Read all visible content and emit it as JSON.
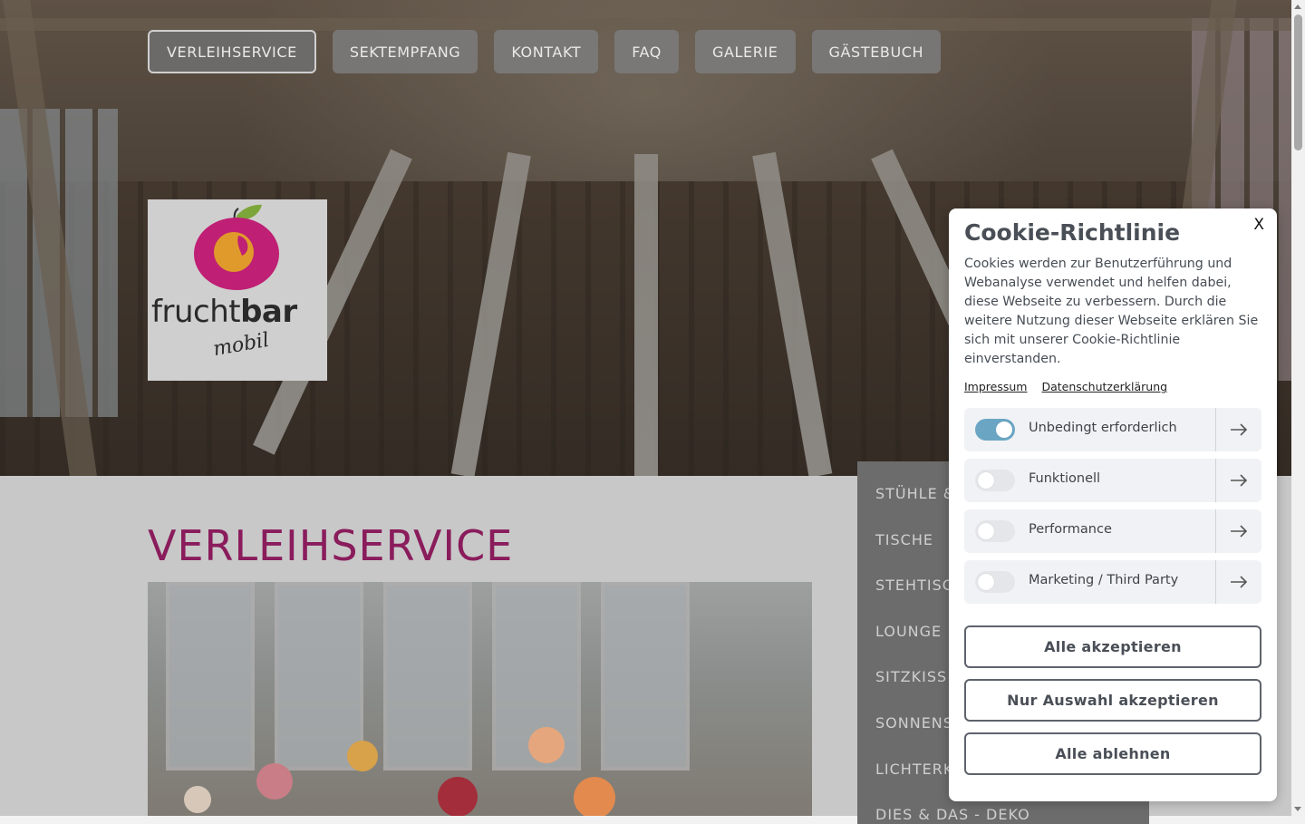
{
  "nav": {
    "items": [
      {
        "label": "VERLEIHSERVICE",
        "active": true
      },
      {
        "label": "SEKTEMPFANG",
        "active": false
      },
      {
        "label": "KONTAKT",
        "active": false
      },
      {
        "label": "FAQ",
        "active": false
      },
      {
        "label": "GALERIE",
        "active": false
      },
      {
        "label": "GÄSTEBUCH",
        "active": false
      }
    ]
  },
  "logo": {
    "word_light": "frucht",
    "word_bold": "bar",
    "sub": "mobil"
  },
  "main": {
    "title": "VERLEIHSERVICE"
  },
  "side_menu": {
    "items": [
      "STÜHLE &",
      "TISCHE",
      "STEHTISC",
      "LOUNGE",
      "SITZKISS",
      "SONNENS",
      "LICHTERK",
      "DIES & DAS - DEKO"
    ]
  },
  "cookie": {
    "title": "Cookie-Richtlinie",
    "close": "X",
    "text": "Cookies werden zur Benutzerführung und Webanalyse verwendet und helfen dabei, diese Webseite zu verbessern. Durch die weitere Nutzung dieser Webseite erklären Sie sich mit unserer Cookie-Richtlinie einverstanden.",
    "links": [
      "Impressum",
      "Datenschutzerklärung"
    ],
    "categories": [
      {
        "label": "Unbedingt erforderlich",
        "enabled": true
      },
      {
        "label": "Funktionell",
        "enabled": false
      },
      {
        "label": "Performance",
        "enabled": false
      },
      {
        "label": "Marketing / Third Party",
        "enabled": false
      }
    ],
    "buttons": {
      "accept_all": "Alle akzeptieren",
      "accept_selection": "Nur Auswahl akzeptieren",
      "reject_all": "Alle ablehnen"
    }
  },
  "colors": {
    "title_accent": "#8a1c5c",
    "toggle_on": "#6aa6c4",
    "nav_bg": "#7d7d7d",
    "side_menu_bg": "#6c6c6c"
  },
  "icons": {
    "category_arrow": "arrow-right-icon",
    "close": "close-icon"
  }
}
